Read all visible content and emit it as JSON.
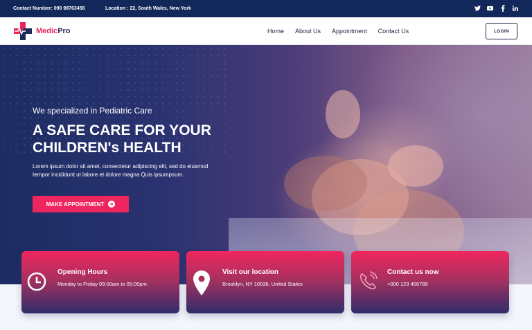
{
  "topbar": {
    "contact": "Contact Number: 090 98763456",
    "location": "Location : 22, South Wales, New York",
    "social": [
      "twitter-icon",
      "youtube-icon",
      "facebook-icon",
      "linkedin-icon"
    ]
  },
  "nav": {
    "brand_medic": "Medic",
    "brand_pro": "Pro",
    "menu": [
      "Home",
      "About Us",
      "Appointment",
      "Contact Us"
    ],
    "login": "LOGIN"
  },
  "hero": {
    "subtitle": "We specialized in Pediatric Care",
    "title": "A SAFE CARE FOR YOUR CHILDREN's HEALTH",
    "description": "Lorem ipsum dolor sit amet, consectetur adipiscing elit, sed do eiusmod tempor incididunt ut labore et dolore magna Quis ipsumpsum.",
    "cta": "MAKE APPOINTMENT"
  },
  "cards": [
    {
      "icon": "clock-icon",
      "title": "Opening Hours",
      "detail": "Monday to Friday 09:00am to 05:00pm"
    },
    {
      "icon": "location-pin-icon",
      "title": "Visit our location",
      "detail": "Brooklyn, NY 10036, United States"
    },
    {
      "icon": "phone-icon",
      "title": "Contact us now",
      "detail": "+000 123 456789"
    }
  ],
  "colors": {
    "navy": "#12285a",
    "accent": "#ee2660",
    "text": "#1d2543"
  }
}
